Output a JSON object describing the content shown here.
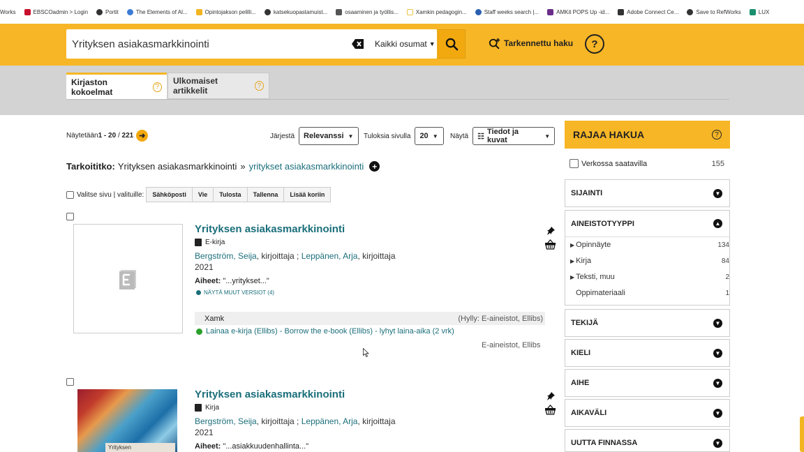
{
  "bookmarks": [
    {
      "label": "Works",
      "color": "#ffffff"
    },
    {
      "label": "EBSCOadmin > Login",
      "color": "#c8102e"
    },
    {
      "label": "Portit",
      "color": "#333333"
    },
    {
      "label": "The Elements of Al...",
      "color": "#3b7bd4"
    },
    {
      "label": "Opintojakson pelilli...",
      "color": "#f2b522"
    },
    {
      "label": "katsekuopastamuist...",
      "color": "#333333"
    },
    {
      "label": "osaaminen ja työllis...",
      "color": "#555555"
    },
    {
      "label": "Xamkin pedagogin...",
      "color": "#e8c547"
    },
    {
      "label": "Staff weeks search |...",
      "color": "#2a5fb0"
    },
    {
      "label": "AMKit POPS Up -id...",
      "color": "#6a2d8a"
    },
    {
      "label": "Adobe Connect Ce...",
      "color": "#333333"
    },
    {
      "label": "Save to RefWorks",
      "color": "#333333"
    },
    {
      "label": "LUX",
      "color": "#1a8f6e"
    }
  ],
  "search": {
    "query": "Yrityksen asiakasmarkkinointi",
    "scope": "Kaikki osumat",
    "advanced": "Tarkennettu haku",
    "help": "?"
  },
  "tabs": [
    {
      "label": "Kirjaston kokoelmat"
    },
    {
      "label": "Ulkomaiset artikkelit"
    }
  ],
  "results": {
    "showing_prefix": "Näytetään ",
    "showing_range": "1 - 20",
    "showing_sep": " / ",
    "showing_total": "221",
    "sort_label": "Järjestä",
    "sort_value": "Relevanssi",
    "perpage_label": "Tuloksia sivulla",
    "perpage_value": "20",
    "view_label": "Näytä",
    "view_value": "Tiedot ja kuvat"
  },
  "didyoumean": {
    "label": "Tarkoititko:",
    "original": "Yrityksen asiakasmarkkinointi",
    "sep": "»",
    "suggestion": "yritykset asiakasmarkkinointi"
  },
  "bulk": {
    "label": "Valitse sivu | valituille:",
    "buttons": [
      "Sähköposti",
      "Vie",
      "Tulosta",
      "Tallenna",
      "Lisää koriin"
    ]
  },
  "records": [
    {
      "title": "Yrityksen asiakasmarkkinointi",
      "format": "E-kirja",
      "author1": "Bergström, Seija",
      "role1": ", kirjoittaja ; ",
      "author2": "Leppänen, Arja",
      "role2": ", kirjoittaja",
      "year": "2021",
      "subjects_label": "Aiheet:",
      "subjects_value": " \"...yritykset...\"",
      "versions": "NÄYTÄ MUUT VERSIOT (4)",
      "holding_org": "Xamk",
      "holding_shelf": "(Hylly: E-aineistot, Ellibs)",
      "loan": "Lainaa e-kirja (Ellibs) - Borrow the e-book (Ellibs) - lyhyt laina-aika (2 vrk)",
      "loan_source": "E-aineistot, Ellibs"
    },
    {
      "title": "Yrityksen asiakasmarkkinointi",
      "format": "Kirja",
      "author1": "Bergström, Seija",
      "role1": ", kirjoittaja ; ",
      "author2": "Leppänen, Arja",
      "role2": ", kirjoittaja",
      "year": "2021",
      "subjects_label": "Aiheet:",
      "subjects_value": " \"...asiakkuudenhallinta...\"",
      "cover_text": "Yrityksen"
    }
  ],
  "sidebar": {
    "title": "RAJAA HAKUA",
    "online_label": "Verkossa saatavilla",
    "online_count": "155",
    "facets": [
      "SIJAINTI",
      "AINEISTOTYYPPI",
      "TEKIJÄ",
      "KIELI",
      "AIHE",
      "AIKAVÄLI",
      "UUTTA FINNASSA"
    ],
    "types": [
      {
        "label": "Opinnäyte",
        "count": "134"
      },
      {
        "label": "Kirja",
        "count": "84"
      },
      {
        "label": "Teksti, muu",
        "count": "2"
      },
      {
        "label": "Oppimateriaali",
        "count": "1"
      }
    ]
  },
  "colors": {
    "accent": "#f7b626",
    "link": "#1a6e7a",
    "available": "#2aa02a"
  }
}
